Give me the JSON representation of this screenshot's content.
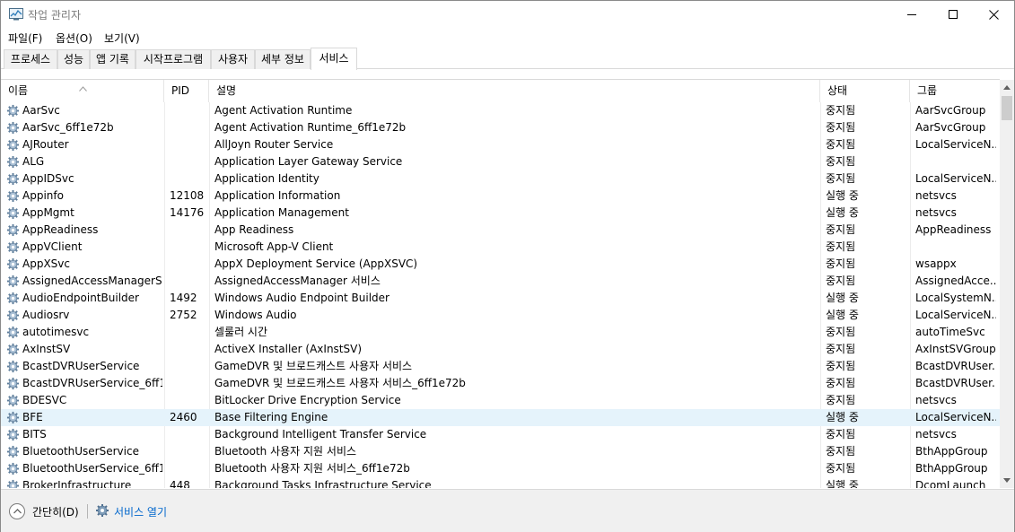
{
  "window": {
    "title": "작업 관리자"
  },
  "menu": [
    "파일(F)",
    "옵션(O)",
    "보기(V)"
  ],
  "tabs": [
    {
      "label": "프로세스",
      "active": false
    },
    {
      "label": "성능",
      "active": false
    },
    {
      "label": "앱 기록",
      "active": false
    },
    {
      "label": "시작프로그램",
      "active": false
    },
    {
      "label": "사용자",
      "active": false
    },
    {
      "label": "세부 정보",
      "active": false
    },
    {
      "label": "서비스",
      "active": true
    }
  ],
  "columns": {
    "name": "이름",
    "pid": "PID",
    "description": "설명",
    "status": "상태",
    "group": "그룹"
  },
  "services": [
    {
      "name": "AarSvc",
      "pid": "",
      "description": "Agent Activation Runtime",
      "status": "중지됨",
      "group": "AarSvcGroup"
    },
    {
      "name": "AarSvc_6ff1e72b",
      "pid": "",
      "description": "Agent Activation Runtime_6ff1e72b",
      "status": "중지됨",
      "group": "AarSvcGroup"
    },
    {
      "name": "AJRouter",
      "pid": "",
      "description": "AllJoyn Router Service",
      "status": "중지됨",
      "group": "LocalServiceN..."
    },
    {
      "name": "ALG",
      "pid": "",
      "description": "Application Layer Gateway Service",
      "status": "중지됨",
      "group": ""
    },
    {
      "name": "AppIDSvc",
      "pid": "",
      "description": "Application Identity",
      "status": "중지됨",
      "group": "LocalServiceN..."
    },
    {
      "name": "Appinfo",
      "pid": "12108",
      "description": "Application Information",
      "status": "실행 중",
      "group": "netsvcs"
    },
    {
      "name": "AppMgmt",
      "pid": "14176",
      "description": "Application Management",
      "status": "실행 중",
      "group": "netsvcs"
    },
    {
      "name": "AppReadiness",
      "pid": "",
      "description": "App Readiness",
      "status": "중지됨",
      "group": "AppReadiness"
    },
    {
      "name": "AppVClient",
      "pid": "",
      "description": "Microsoft App-V Client",
      "status": "중지됨",
      "group": ""
    },
    {
      "name": "AppXSvc",
      "pid": "",
      "description": "AppX Deployment Service (AppXSVC)",
      "status": "중지됨",
      "group": "wsappx"
    },
    {
      "name": "AssignedAccessManagerSvc",
      "pid": "",
      "description": "AssignedAccessManager 서비스",
      "status": "중지됨",
      "group": "AssignedAcce..."
    },
    {
      "name": "AudioEndpointBuilder",
      "pid": "1492",
      "description": "Windows Audio Endpoint Builder",
      "status": "실행 중",
      "group": "LocalSystemN..."
    },
    {
      "name": "Audiosrv",
      "pid": "2752",
      "description": "Windows Audio",
      "status": "실행 중",
      "group": "LocalServiceN..."
    },
    {
      "name": "autotimesvc",
      "pid": "",
      "description": "셀룰러 시간",
      "status": "중지됨",
      "group": "autoTimeSvc"
    },
    {
      "name": "AxInstSV",
      "pid": "",
      "description": "ActiveX Installer (AxInstSV)",
      "status": "중지됨",
      "group": "AxInstSVGroup"
    },
    {
      "name": "BcastDVRUserService",
      "pid": "",
      "description": "GameDVR 및 브로드캐스트 사용자 서비스",
      "status": "중지됨",
      "group": "BcastDVRUser..."
    },
    {
      "name": "BcastDVRUserService_6ff1...",
      "pid": "",
      "description": "GameDVR 및 브로드캐스트 사용자 서비스_6ff1e72b",
      "status": "중지됨",
      "group": "BcastDVRUser..."
    },
    {
      "name": "BDESVC",
      "pid": "",
      "description": "BitLocker Drive Encryption Service",
      "status": "중지됨",
      "group": "netsvcs"
    },
    {
      "name": "BFE",
      "pid": "2460",
      "description": "Base Filtering Engine",
      "status": "실행 중",
      "group": "LocalServiceN...",
      "selected": true
    },
    {
      "name": "BITS",
      "pid": "",
      "description": "Background Intelligent Transfer Service",
      "status": "중지됨",
      "group": "netsvcs"
    },
    {
      "name": "BluetoothUserService",
      "pid": "",
      "description": "Bluetooth 사용자 지원 서비스",
      "status": "중지됨",
      "group": "BthAppGroup"
    },
    {
      "name": "BluetoothUserService_6ff1...",
      "pid": "",
      "description": "Bluetooth 사용자 지원 서비스_6ff1e72b",
      "status": "중지됨",
      "group": "BthAppGroup"
    },
    {
      "name": "BrokerInfrastructure",
      "pid": "448",
      "description": "Background Tasks Infrastructure Service",
      "status": "실행 중",
      "group": "DcomLaunch"
    }
  ],
  "footer": {
    "fewer_details": "간단히(D)",
    "open_services": "서비스 열기"
  },
  "colors": {
    "selected_row": "#e5f3fb",
    "link": "#0066cc",
    "footer_bg": "#f0f0f0"
  },
  "icons": {
    "app": "task-manager-icon",
    "service": "gear-icon",
    "fewer": "chevron-up-icon"
  }
}
